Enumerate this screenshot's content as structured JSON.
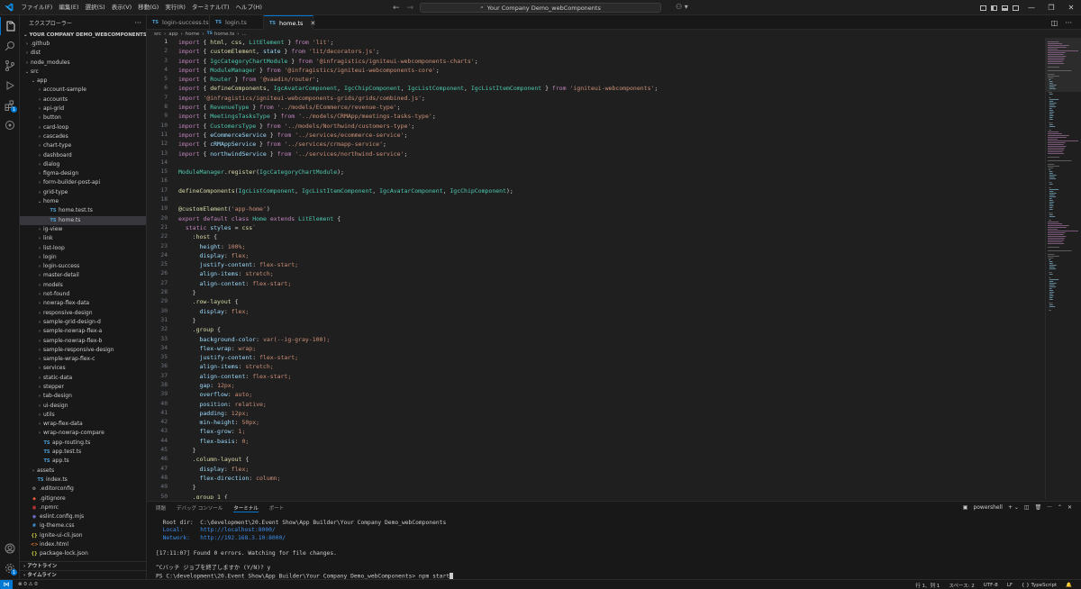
{
  "menu": [
    "ファイル(F)",
    "編集(E)",
    "選択(S)",
    "表示(V)",
    "移動(G)",
    "実行(R)",
    "ターミナル(T)",
    "ヘルプ(H)"
  ],
  "command_center": "Your Company Demo_webComponents",
  "explorer": {
    "title": "エクスプローラー",
    "project": "YOUR COMPANY DEMO_WEBCOMPONENTS",
    "tree": [
      {
        "label": ".github",
        "indent": 1,
        "kind": "folder",
        "open": false
      },
      {
        "label": "dist",
        "indent": 1,
        "kind": "folder",
        "open": false
      },
      {
        "label": "node_modules",
        "indent": 1,
        "kind": "folder",
        "open": false
      },
      {
        "label": "src",
        "indent": 1,
        "kind": "folder",
        "open": true
      },
      {
        "label": "app",
        "indent": 2,
        "kind": "folder",
        "open": true
      },
      {
        "label": "account-sample",
        "indent": 3,
        "kind": "folder",
        "open": false
      },
      {
        "label": "accounts",
        "indent": 3,
        "kind": "folder",
        "open": false
      },
      {
        "label": "api-grid",
        "indent": 3,
        "kind": "folder",
        "open": false
      },
      {
        "label": "button",
        "indent": 3,
        "kind": "folder",
        "open": false
      },
      {
        "label": "card-loop",
        "indent": 3,
        "kind": "folder",
        "open": false
      },
      {
        "label": "cascades",
        "indent": 3,
        "kind": "folder",
        "open": false
      },
      {
        "label": "chart-type",
        "indent": 3,
        "kind": "folder",
        "open": false
      },
      {
        "label": "dashboard",
        "indent": 3,
        "kind": "folder",
        "open": false
      },
      {
        "label": "dialog",
        "indent": 3,
        "kind": "folder",
        "open": false
      },
      {
        "label": "figma-design",
        "indent": 3,
        "kind": "folder",
        "open": false
      },
      {
        "label": "form-builder-post-api",
        "indent": 3,
        "kind": "folder",
        "open": false
      },
      {
        "label": "grid-type",
        "indent": 3,
        "kind": "folder",
        "open": false
      },
      {
        "label": "home",
        "indent": 3,
        "kind": "folder",
        "open": true
      },
      {
        "label": "home.test.ts",
        "indent": 4,
        "kind": "ts"
      },
      {
        "label": "home.ts",
        "indent": 4,
        "kind": "ts",
        "selected": true
      },
      {
        "label": "ig-view",
        "indent": 3,
        "kind": "folder",
        "open": false
      },
      {
        "label": "link",
        "indent": 3,
        "kind": "folder",
        "open": false
      },
      {
        "label": "list-loop",
        "indent": 3,
        "kind": "folder",
        "open": false
      },
      {
        "label": "login",
        "indent": 3,
        "kind": "folder",
        "open": false
      },
      {
        "label": "login-success",
        "indent": 3,
        "kind": "folder",
        "open": false
      },
      {
        "label": "master-detail",
        "indent": 3,
        "kind": "folder",
        "open": false
      },
      {
        "label": "models",
        "indent": 3,
        "kind": "folder",
        "open": false
      },
      {
        "label": "not-found",
        "indent": 3,
        "kind": "folder",
        "open": false
      },
      {
        "label": "nowrap-flex-data",
        "indent": 3,
        "kind": "folder",
        "open": false
      },
      {
        "label": "responsive-design",
        "indent": 3,
        "kind": "folder",
        "open": false
      },
      {
        "label": "sample-grid-design-d",
        "indent": 3,
        "kind": "folder",
        "open": false
      },
      {
        "label": "sample-nowrap-flex-a",
        "indent": 3,
        "kind": "folder",
        "open": false
      },
      {
        "label": "sample-nowrap-flex-b",
        "indent": 3,
        "kind": "folder",
        "open": false
      },
      {
        "label": "sample-responsive-design",
        "indent": 3,
        "kind": "folder",
        "open": false
      },
      {
        "label": "sample-wrap-flex-c",
        "indent": 3,
        "kind": "folder",
        "open": false
      },
      {
        "label": "services",
        "indent": 3,
        "kind": "folder",
        "open": false
      },
      {
        "label": "static-data",
        "indent": 3,
        "kind": "folder",
        "open": false
      },
      {
        "label": "stepper",
        "indent": 3,
        "kind": "folder",
        "open": false
      },
      {
        "label": "tab-design",
        "indent": 3,
        "kind": "folder",
        "open": false
      },
      {
        "label": "ui-design",
        "indent": 3,
        "kind": "folder",
        "open": false
      },
      {
        "label": "utils",
        "indent": 3,
        "kind": "folder",
        "open": false
      },
      {
        "label": "wrap-flex-data",
        "indent": 3,
        "kind": "folder",
        "open": false
      },
      {
        "label": "wrap-nowrap-compare",
        "indent": 3,
        "kind": "folder",
        "open": false
      },
      {
        "label": "app-routing.ts",
        "indent": 3,
        "kind": "ts"
      },
      {
        "label": "app.test.ts",
        "indent": 3,
        "kind": "ts"
      },
      {
        "label": "app.ts",
        "indent": 3,
        "kind": "ts"
      },
      {
        "label": "assets",
        "indent": 2,
        "kind": "folder",
        "open": false
      },
      {
        "label": "index.ts",
        "indent": 2,
        "kind": "ts"
      },
      {
        "label": ".editorconfig",
        "indent": 1,
        "kind": "gear"
      },
      {
        "label": ".gitignore",
        "indent": 1,
        "kind": "git"
      },
      {
        "label": ".npmrc",
        "indent": 1,
        "kind": "npm"
      },
      {
        "label": "eslint.config.mjs",
        "indent": 1,
        "kind": "js"
      },
      {
        "label": "ig-theme.css",
        "indent": 1,
        "kind": "css"
      },
      {
        "label": "ignite-ui-cli.json",
        "indent": 1,
        "kind": "json"
      },
      {
        "label": "index.html",
        "indent": 1,
        "kind": "html"
      },
      {
        "label": "package-lock.json",
        "indent": 1,
        "kind": "json"
      }
    ],
    "outline": "アウトライン",
    "timeline": "タイムライン"
  },
  "tabs": [
    {
      "label": "login-success.ts",
      "active": false
    },
    {
      "label": "login.ts",
      "active": false
    },
    {
      "label": "home.ts",
      "active": true
    }
  ],
  "breadcrumb": [
    "src",
    "app",
    "home",
    "home.ts",
    "..."
  ],
  "code_lines": [
    "import { html, css, LitElement } from 'lit';",
    "import { customElement, state } from 'lit/decorators.js';",
    "import { IgcCategoryChartModule } from '@infragistics/igniteui-webcomponents-charts';",
    "import { ModuleManager } from '@infragistics/igniteui-webcomponents-core';",
    "import { Router } from '@vaadin/router';",
    "import { defineComponents, IgcAvatarComponent, IgcChipComponent, IgcListComponent, IgcListItemComponent } from 'igniteui-webcomponents';",
    "import '@infragistics/igniteui-webcomponents-grids/grids/combined.js';",
    "import { RevenueType } from '../models/ECommerce/revenue-type';",
    "import { MeetingsTasksType } from '../models/CRMApp/meetings-tasks-type';",
    "import { CustomersType } from '../models/Northwind/customers-type';",
    "import { eCommerceService } from '../services/ecommerce-service';",
    "import { cRMAppService } from '../services/crmapp-service';",
    "import { northwindService } from '../services/northwind-service';",
    "",
    "ModuleManager.register(IgcCategoryChartModule);",
    "",
    "defineComponents(IgcListComponent, IgcListItemComponent, IgcAvatarComponent, IgcChipComponent);",
    "",
    "@customElement('app-home')",
    "export default class Home extends LitElement {",
    "  static styles = css`",
    "    :host {",
    "      height: 100%;",
    "      display: flex;",
    "      justify-content: flex-start;",
    "      align-items: stretch;",
    "      align-content: flex-start;",
    "    }",
    "    .row-layout {",
    "      display: flex;",
    "    }",
    "    .group {",
    "      background-color: var(--ig-gray-100);",
    "      flex-wrap: wrap;",
    "      justify-content: flex-start;",
    "      align-items: stretch;",
    "      align-content: flex-start;",
    "      gap: 12px;",
    "      overflow: auto;",
    "      position: relative;",
    "      padding: 12px;",
    "      min-height: 50px;",
    "      flex-grow: 1;",
    "      flex-basis: 0;",
    "    }",
    "    .column-layout {",
    "      display: flex;",
    "      flex-direction: column;",
    "    }",
    "    .group_1 {"
  ],
  "panel": {
    "tabs": [
      "問題",
      "デバッグ コンソール",
      "ターミナル",
      "ポート"
    ],
    "active_tab": "ターミナル",
    "shell": "powershell",
    "terminal_lines": [
      "  Root dir:  C:\\development\\20.Event Show\\App Builder\\Your Company Demo_webComponents",
      "  Local:     http://localhost:8000/",
      "  Network:   http://192.168.3.10:8000/",
      "",
      "[17:11:07] Found 0 errors. Watching for file changes.",
      "",
      "^Cバッチ ジョブを終了しますか (Y/N)? y",
      "PS C:\\development\\20.Event Show\\App Builder\\Your Company Demo_webComponents> npm start"
    ]
  },
  "status": {
    "problems": "⊗ 0 ⚠ 0",
    "position": "行 1、列 1",
    "spaces": "スペース: 2",
    "encoding": "UTF-8",
    "eol": "LF",
    "language": "TypeScript"
  },
  "colors": {
    "accent": "#0078d4",
    "keyword": "#c586c0",
    "string": "#ce9178",
    "type": "#4ec9b0",
    "function": "#dcdcaa",
    "variable": "#9cdcfe"
  }
}
